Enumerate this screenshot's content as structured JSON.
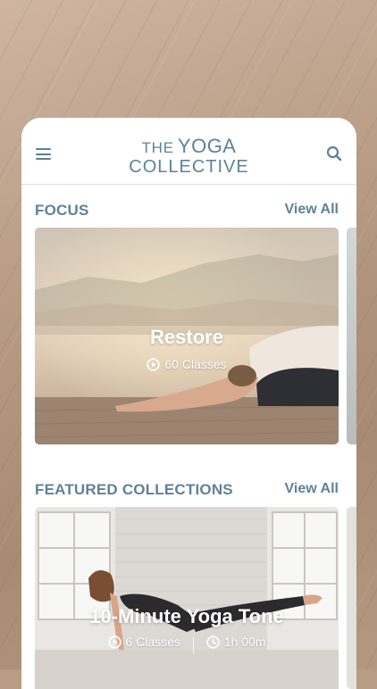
{
  "header": {
    "logo_the": "THE",
    "logo_line1": "YOGA",
    "logo_line2": "COLLECTIVE",
    "menu_icon": "hamburger-menu-icon",
    "search_icon": "search-icon"
  },
  "focus": {
    "title": "FOCUS",
    "view_all": "View All",
    "card": {
      "title": "Restore",
      "classes": "60 Classes",
      "icon": "play-circle-icon"
    }
  },
  "featured": {
    "title": "FEATURED COLLECTIONS",
    "view_all": "View All",
    "card": {
      "title": "10-Minute Yoga Tone",
      "classes": "6 Classes",
      "duration": "1h 00m",
      "icons": [
        "play-circle-icon",
        "clock-icon"
      ]
    }
  },
  "colors": {
    "accent": "#5f8297",
    "background": "#ffffff"
  }
}
